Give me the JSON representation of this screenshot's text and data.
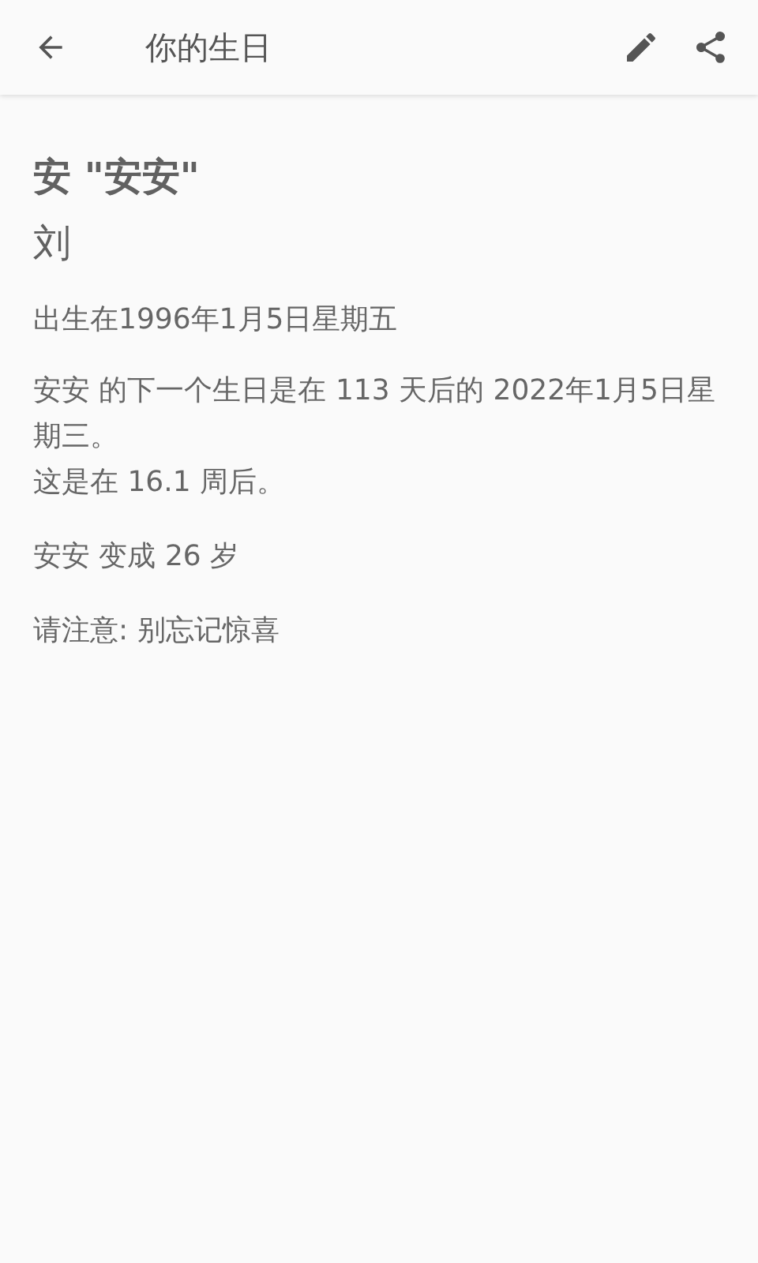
{
  "toolbar": {
    "title": "你的生日"
  },
  "detail": {
    "name": "安 \"安安\"",
    "surname": "刘",
    "born": "出生在1996年1月5日星期五",
    "next_birthday": [
      "安安 的下一个生日是在 113 天后的 2022年1月5日星期三。",
      "这是在 16.1 周后。"
    ],
    "age": "安安 变成 26 岁",
    "note": "请注意: 别忘记惊喜"
  }
}
